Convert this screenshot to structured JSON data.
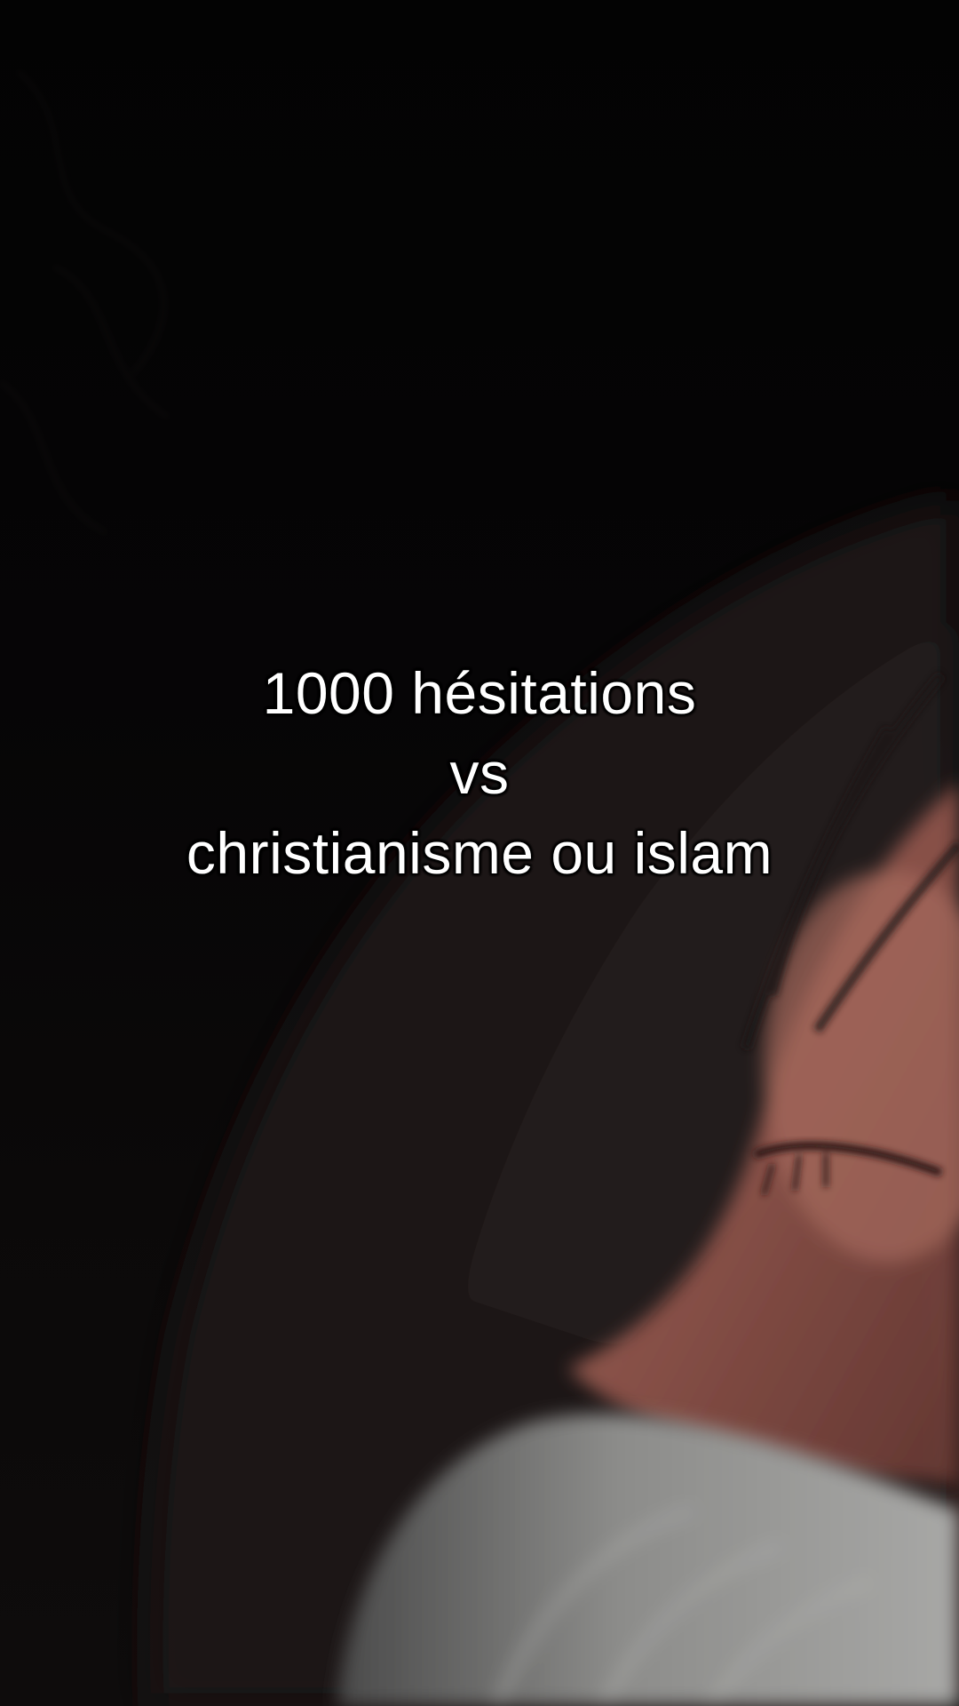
{
  "caption": {
    "line1": "1000 hésitations",
    "line2": "vs",
    "line3": "christianisme ou islam"
  },
  "colors": {
    "background": "#050405",
    "caption_text": "#ffffff",
    "caption_outline": "#000000",
    "skin": "#9a5a50",
    "hair": "#1a1414",
    "sweater": "#8a8a88"
  }
}
